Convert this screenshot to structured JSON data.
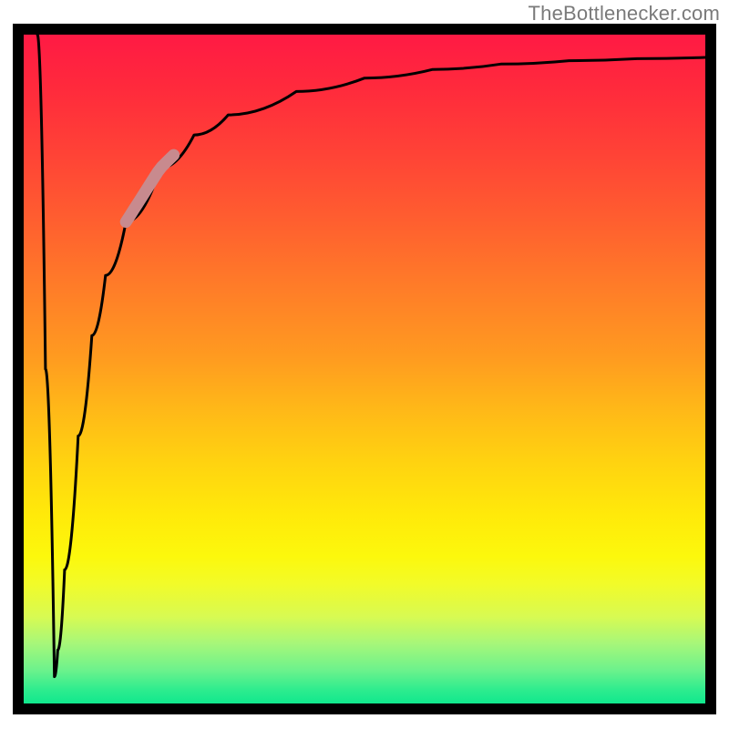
{
  "watermark": "TheBottlenecker.com",
  "chart_data": {
    "type": "line",
    "title": "",
    "xlabel": "",
    "ylabel": "",
    "xlim": [
      0,
      100
    ],
    "ylim": [
      0,
      100
    ],
    "curve_comment": "Values estimated from pixel positions. y=0 is bottom edge, y=100 is top edge of plotting area.",
    "x": [
      2,
      3.2,
      4.5,
      5,
      6,
      8,
      10,
      12,
      15,
      20,
      25,
      30,
      40,
      50,
      60,
      70,
      80,
      90,
      100
    ],
    "y": [
      100,
      50,
      4,
      8,
      20,
      40,
      55,
      64,
      72,
      80,
      85,
      88,
      91.5,
      93.5,
      94.8,
      95.6,
      96.1,
      96.4,
      96.6
    ],
    "highlight_segment": {
      "x_start": 15,
      "x_end": 22
    },
    "background_gradient": {
      "orientation": "vertical",
      "stops": [
        {
          "pos": 0.0,
          "color": "#ff1a44"
        },
        {
          "pos": 0.4,
          "color": "#ff8a24"
        },
        {
          "pos": 0.7,
          "color": "#ffe80c"
        },
        {
          "pos": 1.0,
          "color": "#10e88d"
        }
      ]
    }
  }
}
